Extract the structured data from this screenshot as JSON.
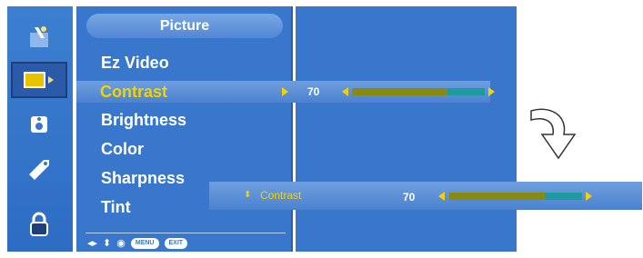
{
  "sidebar": {
    "icons": [
      {
        "name": "picture-magic-icon"
      },
      {
        "name": "screen-icon"
      },
      {
        "name": "sound-lock-icon"
      },
      {
        "name": "tag-icon"
      },
      {
        "name": "padlock-icon"
      }
    ]
  },
  "menu": {
    "title": "Picture",
    "items": [
      "Ez Video",
      "Contrast",
      "Brightness",
      "Color",
      "Sharpness",
      "Tint"
    ],
    "selected_index": 1
  },
  "contrast_control": {
    "label": "Contrast",
    "value": "70",
    "level": 0.72
  },
  "popup": {
    "label": "Contrast",
    "value": "70",
    "level": 0.72
  },
  "bottom_bar": {
    "menu_badge": "MENU",
    "exit_badge": "EXIT"
  },
  "colors": {
    "panel_blue": "#3877cc",
    "highlight_text": "#f2d200",
    "bar_fill": "#8a8a10",
    "bar_track": "#1e9aa0"
  }
}
